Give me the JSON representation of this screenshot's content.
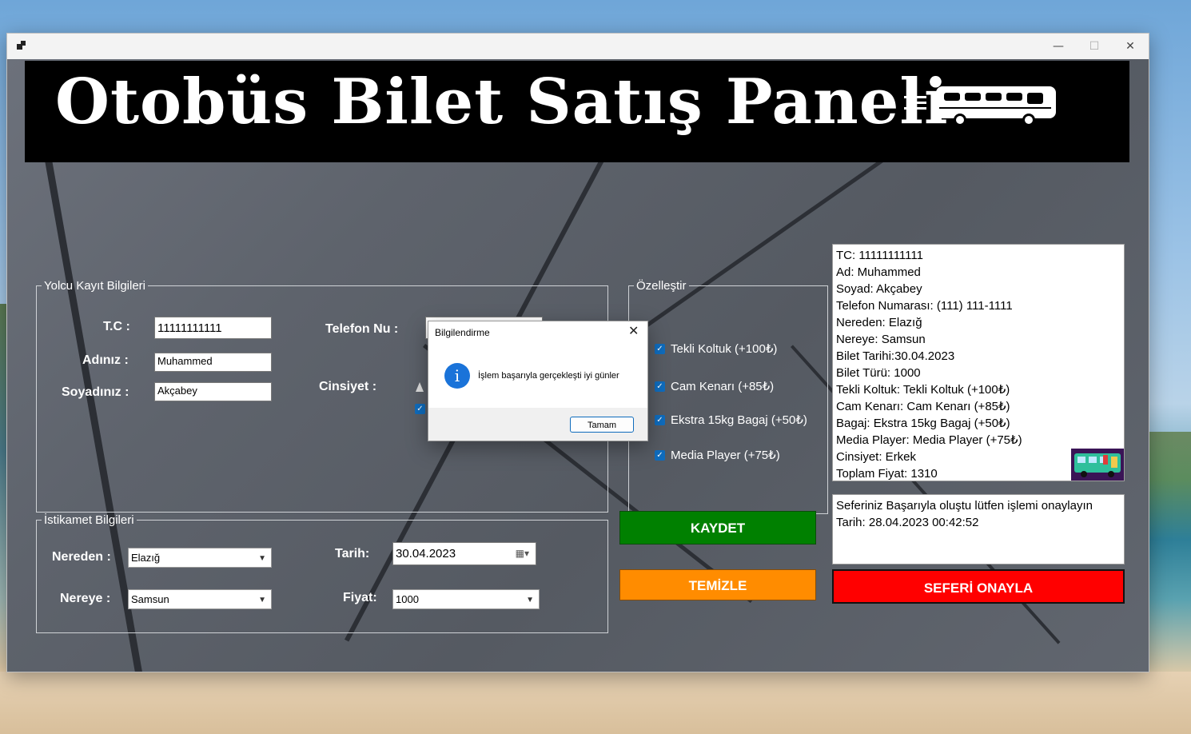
{
  "window": {
    "title": "",
    "controls": {
      "minimize": "—",
      "maximize": "☐",
      "close": "✕"
    }
  },
  "header": {
    "title": "Otobüs Bilet Satış Paneli",
    "icon": "bus-icon"
  },
  "yolcu": {
    "legend": "Yolcu Kayıt Bilgileri",
    "tc_label": "T.C :",
    "tc_value": "11111111111",
    "ad_label": "Adınız :",
    "ad_value": "Muhammed",
    "soyad_label": "Soyadınız :",
    "soyad_value": "Akçabey",
    "telefon_label": "Telefon Nu :",
    "cinsiyet_label": "Cinsiyet :"
  },
  "istikamet": {
    "legend": "İstikamet Bilgileri",
    "nereden_label": "Nereden :",
    "nereden_value": "Elazığ",
    "nereye_label": "Nereye :",
    "nereye_value": "Samsun",
    "tarih_label": "Tarih:",
    "tarih_value": "30.04.2023",
    "fiyat_label": "Fiyat:",
    "fiyat_value": "1000"
  },
  "ozellestir": {
    "legend": "Özelleştir",
    "options": [
      {
        "label": "Tekli Koltuk (+100₺)",
        "checked": true
      },
      {
        "label": "Cam Kenarı (+85₺)",
        "checked": true
      },
      {
        "label": "Ekstra 15kg Bagaj (+50₺)",
        "checked": true
      },
      {
        "label": "Media Player (+75₺)",
        "checked": true
      }
    ]
  },
  "summary": {
    "lines": [
      "TC: 11111111111",
      "Ad: Muhammed",
      "Soyad: Akçabey",
      "Telefon Numarası: (111) 111-1111",
      "Nereden: Elazığ",
      "Nereye: Samsun",
      "Bilet Tarihi:30.04.2023",
      "Bilet Türü: 1000",
      "Tekli Koltuk: Tekli Koltuk (+100₺)",
      "Cam Kenarı: Cam Kenarı (+85₺)",
      "Bagaj: Ekstra 15kg Bagaj (+50₺)",
      "Media Player: Media Player (+75₺)",
      "Cinsiyet: Erkek",
      "Toplam Fiyat: 1310"
    ]
  },
  "status": {
    "lines": [
      "Seferiniz Başarıyla oluştu lütfen işlemi onaylayın",
      "Tarih: 28.04.2023 00:42:52"
    ]
  },
  "buttons": {
    "kaydet": "KAYDET",
    "temizle": "TEMİZLE",
    "onayla": "SEFERİ ONAYLA"
  },
  "colors": {
    "kaydet": "#008000",
    "temizle": "#ff8c00",
    "onayla": "#ff0000"
  },
  "dialog": {
    "title": "Bilgilendirme",
    "message": "İşlem başarıyla gerçekleşti iyi günler",
    "ok": "Tamam",
    "icon": "info-icon",
    "close": "✕"
  }
}
